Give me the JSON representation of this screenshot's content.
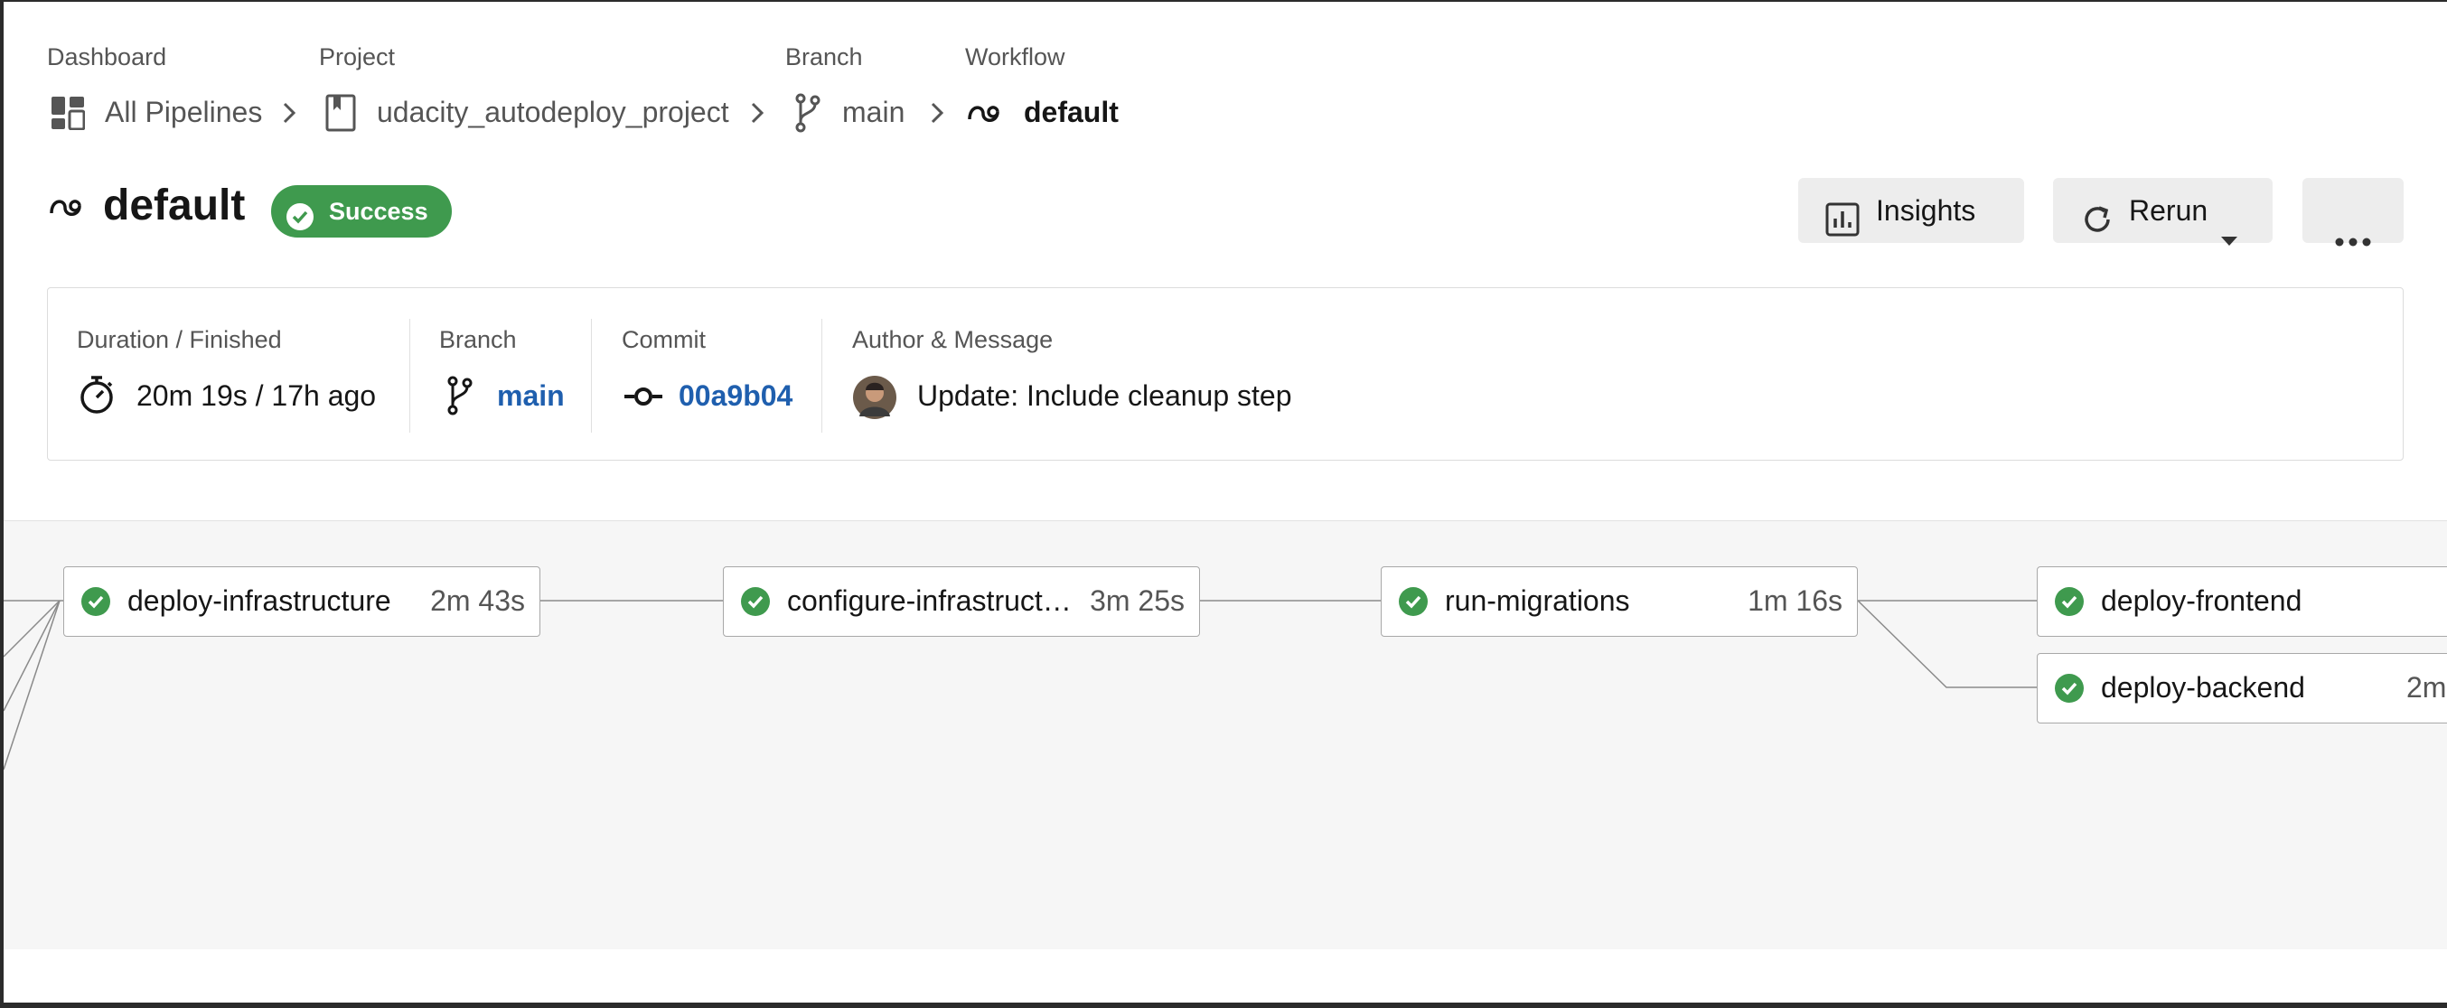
{
  "breadcrumb": [
    {
      "label": "Dashboard",
      "value": "All Pipelines",
      "icon": "dashboard-icon"
    },
    {
      "label": "Project",
      "value": "udacity_autodeploy_project",
      "icon": "project-book-icon"
    },
    {
      "label": "Branch",
      "value": "main",
      "icon": "branch-icon"
    },
    {
      "label": "Workflow",
      "value": "default",
      "icon": "workflow-icon"
    }
  ],
  "header": {
    "title": "default",
    "status": "Success",
    "insights_label": "Insights",
    "rerun_label": "Rerun",
    "more_label": "•••"
  },
  "summary": {
    "duration_label": "Duration / Finished",
    "duration_value": "20m 19s / 17h ago",
    "branch_label": "Branch",
    "branch_value": "main",
    "commit_label": "Commit",
    "commit_value": "00a9b04",
    "author_label": "Author & Message",
    "message": "Update: Include cleanup step"
  },
  "jobs": [
    {
      "name": "deploy-infrastructure",
      "duration": "2m 43s",
      "status": "success"
    },
    {
      "name": "configure-infrastructu…",
      "duration": "3m 25s",
      "status": "success"
    },
    {
      "name": "run-migrations",
      "duration": "1m 16s",
      "status": "success"
    },
    {
      "name": "deploy-frontend",
      "duration": "",
      "status": "success"
    },
    {
      "name": "deploy-backend",
      "duration": "2m",
      "status": "success"
    }
  ],
  "colors": {
    "success": "#3f9a4e",
    "link": "#1f5fae",
    "graph_bg": "#f6f6f6"
  }
}
